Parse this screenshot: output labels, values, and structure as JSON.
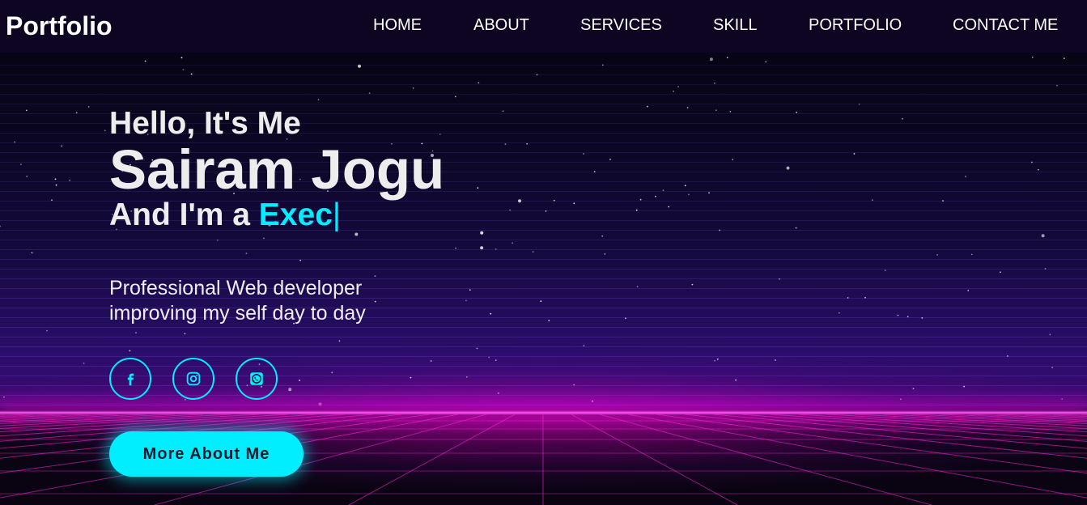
{
  "nav": {
    "logo": "Portfolio",
    "items": [
      {
        "label": "HOME"
      },
      {
        "label": "ABOUT"
      },
      {
        "label": "SERVICES"
      },
      {
        "label": "SKILL"
      },
      {
        "label": "PORTFOLIO"
      },
      {
        "label": "CONTACT ME"
      }
    ]
  },
  "hero": {
    "greeting": "Hello, It's Me",
    "name": "Sairam Jogu",
    "role_prefix": "And I'm a ",
    "role_typed": "Exec",
    "cursor": "|",
    "description_line1": "Professional Web developer",
    "description_line2": "improving my self day to day",
    "cta_label": "More About Me"
  },
  "socials": [
    {
      "icon": "facebook-icon"
    },
    {
      "icon": "instagram-icon"
    },
    {
      "icon": "whatsapp-icon"
    }
  ],
  "colors": {
    "accent": "#00eeff",
    "nav_bg": "#0d0522",
    "glow": "#ff3cf5"
  }
}
